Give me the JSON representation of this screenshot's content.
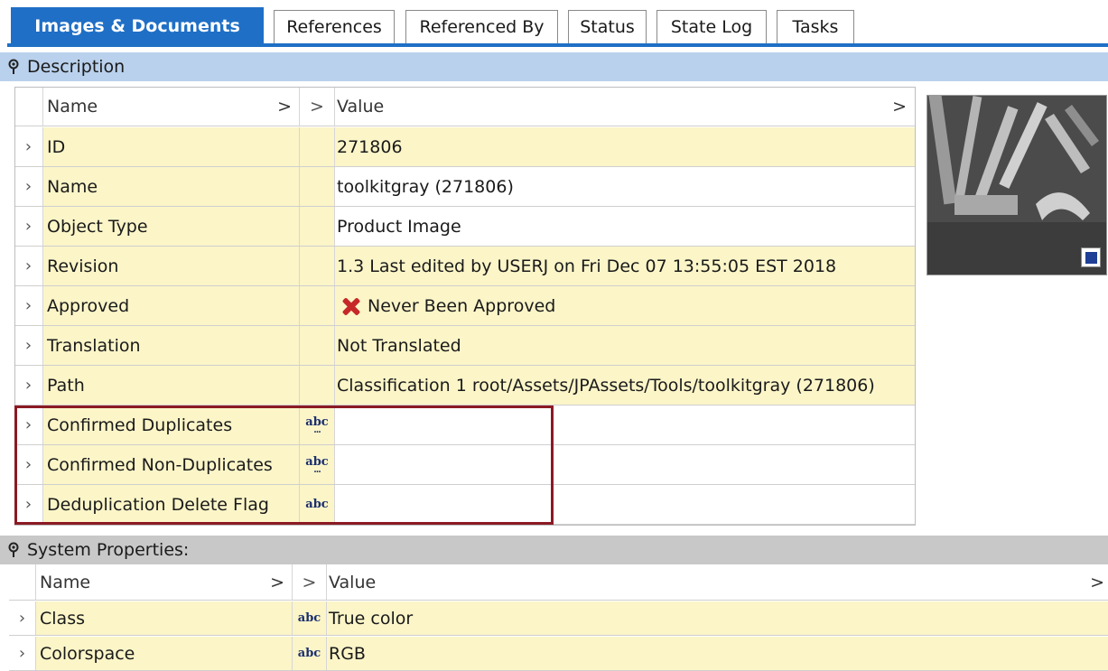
{
  "tabs": [
    {
      "label": "Images & Documents",
      "active": true
    },
    {
      "label": "References",
      "active": false
    },
    {
      "label": "Referenced By",
      "active": false
    },
    {
      "label": "Status",
      "active": false
    },
    {
      "label": "State Log",
      "active": false
    },
    {
      "label": "Tasks",
      "active": false
    }
  ],
  "description_section": {
    "title": "Description",
    "header": {
      "name": "Name",
      "value": "Value",
      "chevron": ">"
    },
    "rows": [
      {
        "name": "ID",
        "value": "271806"
      },
      {
        "name": "Name",
        "value": "toolkitgray (271806)"
      },
      {
        "name": "Object Type",
        "value": "Product Image"
      },
      {
        "name": "Revision",
        "value": "1.3 Last edited by USERJ on Fri Dec 07 13:55:05 EST 2018"
      },
      {
        "name": "Approved",
        "value": "Never Been Approved",
        "icon": "red-x-icon"
      },
      {
        "name": "Translation",
        "value": "Not Translated"
      },
      {
        "name": "Path",
        "value": "Classification 1 root/Assets/JPAssets/Tools/toolkitgray (271806)"
      },
      {
        "name": "Confirmed Duplicates",
        "value": "",
        "type_icon": "abc-multi-icon"
      },
      {
        "name": "Confirmed Non-Duplicates",
        "value": "",
        "type_icon": "abc-multi-icon"
      },
      {
        "name": "Deduplication Delete Flag",
        "value": "",
        "type_icon": "abc-icon"
      }
    ]
  },
  "type_icon_text": "abc",
  "system_section": {
    "title": "System Properties:",
    "header": {
      "name": "Name",
      "value": "Value",
      "chevron": ">"
    },
    "rows": [
      {
        "name": "Class",
        "value": "True color",
        "type_icon": "abc-icon"
      },
      {
        "name": "Colorspace",
        "value": "RGB",
        "type_icon": "abc-icon"
      }
    ]
  },
  "colors": {
    "tab_active": "#1f6fc6",
    "band_blue": "#b9d1ec",
    "band_gray": "#c8c8c8",
    "cell_yellow": "#fbf5c8",
    "highlight": "#8b1a24"
  },
  "thumbnail": {
    "icon": "tools-thumbnail-image"
  }
}
